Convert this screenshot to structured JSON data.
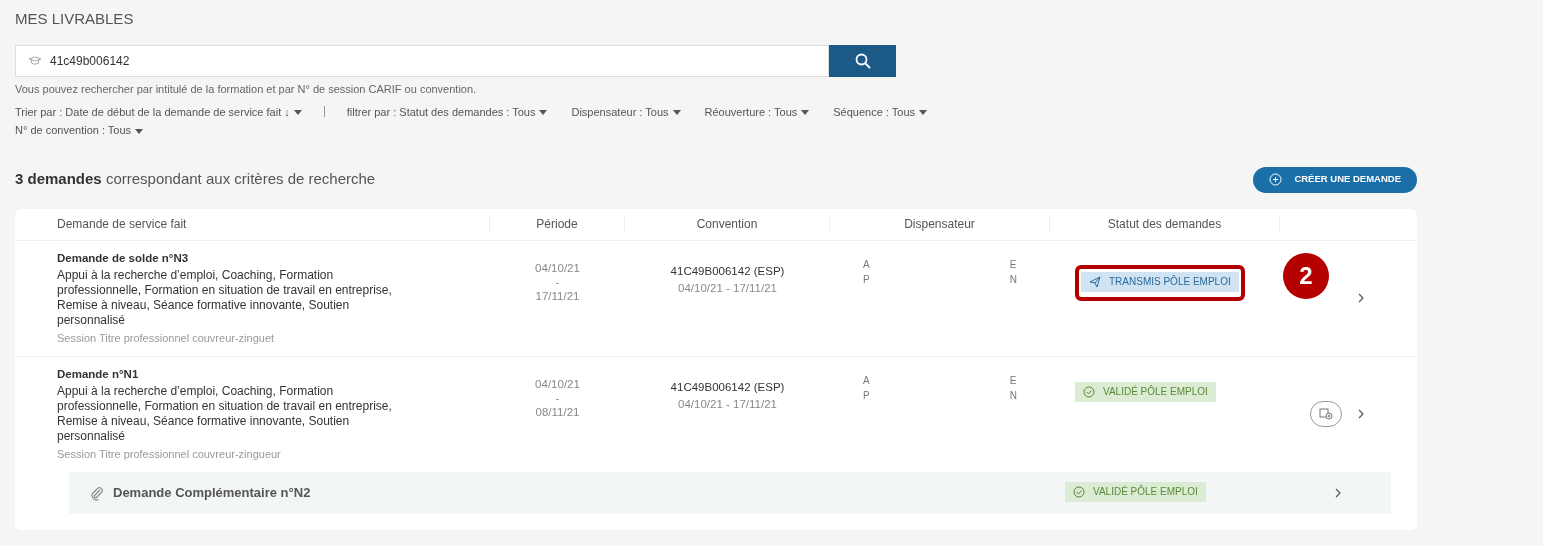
{
  "page_title": "MES LIVRABLES",
  "search": {
    "value": "41c49b006142",
    "hint": "Vous pouvez rechercher par intitulé de la formation et par N° de session CARIF ou convention."
  },
  "sort": {
    "label": "Trier par : Date de début de la demande de service fait ↓"
  },
  "filters": [
    {
      "label": "filtrer par : Statut des demandes : Tous"
    },
    {
      "label": "Dispensateur : Tous"
    },
    {
      "label": "Réouverture : Tous"
    },
    {
      "label": "Séquence : Tous"
    },
    {
      "label": "N° de convention : Tous"
    }
  ],
  "results": {
    "count": "3 demandes",
    "text": "correspondant aux critères de recherche"
  },
  "create_button": "CRÉER UNE DEMANDE",
  "table": {
    "columns": [
      "Demande de service fait",
      "Période",
      "Convention",
      "Dispensateur",
      "Statut des demandes"
    ],
    "rows": [
      {
        "title": "Demande de solde n°N3",
        "description": "Appui à la recherche d’emploi, Coaching, Formation professionnelle, Formation en situation de travail en entreprise, Remise à niveau, Séance formative innovante, Soutien personnalisé",
        "session": "Session Titre professionnel couvreur-zinguet",
        "period_start": "04/10/21",
        "period_sep": "-",
        "period_end": "17/11/21",
        "convention": "41C49B006142 (ESP)",
        "convention_period": "04/10/21 - 17/11/21",
        "dispensateur_left": [
          "A",
          "P"
        ],
        "dispensateur_right": [
          "E",
          "N"
        ],
        "status": {
          "kind": "sent",
          "label": "TRANSMIS PÔLE EMPLOI"
        },
        "callout": "2",
        "add_document": false
      },
      {
        "title": "Demande n°N1",
        "description": "Appui à la recherche d’emploi, Coaching, Formation professionnelle, Formation en situation de travail en entreprise, Remise à niveau, Séance formative innovante, Soutien personnalisé",
        "session": "Session Titre professionnel couvreur-zingueur",
        "period_start": "04/10/21",
        "period_sep": "-",
        "period_end": "08/11/21",
        "convention": "41C49B006142 (ESP)",
        "convention_period": "04/10/21 - 17/11/21",
        "dispensateur_left": [
          "A",
          "P"
        ],
        "dispensateur_right": [
          "E",
          "N"
        ],
        "status": {
          "kind": "validated",
          "label": "VALIDÉ PÔLE EMPLOI"
        },
        "add_document": true,
        "children": [
          {
            "title": "Demande Complémentaire n°N2",
            "status": {
              "kind": "validated",
              "label": "VALIDÉ PÔLE EMPLOI"
            }
          }
        ]
      }
    ]
  }
}
